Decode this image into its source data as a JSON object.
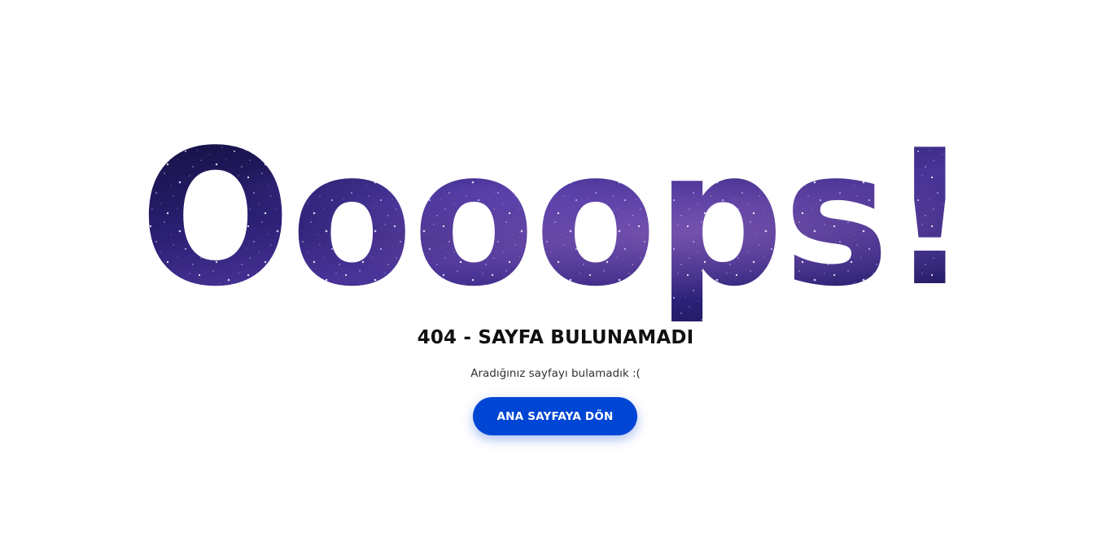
{
  "hero": {
    "text": "Oooops!"
  },
  "error": {
    "title": "404 - SAYFA BULUNAMADI",
    "message": "Aradığınız sayfayı bulamadık :("
  },
  "actions": {
    "home_label": "ANA SAYFAYA DÖN"
  },
  "colors": {
    "button": "#0046d5",
    "space_dark": "#0e0c35",
    "space_purple": "#3a2a8e",
    "title_text": "#111111"
  }
}
